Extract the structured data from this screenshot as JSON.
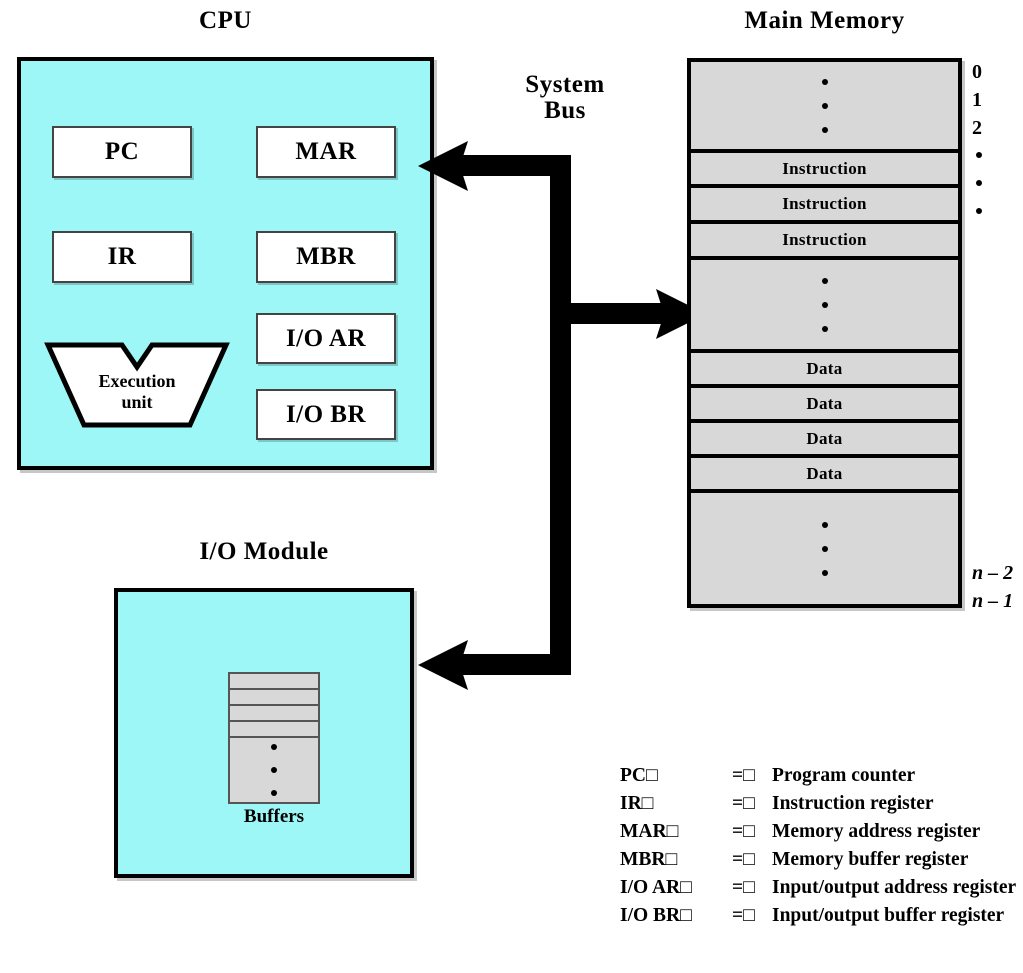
{
  "colors": {
    "component_fill": "#9ef7f7",
    "memory_fill": "#d8d8d8",
    "stroke": "#000000",
    "background": "#ffffff"
  },
  "cpu": {
    "title": "CPU",
    "registers": [
      {
        "label": "PC"
      },
      {
        "label": "MAR"
      },
      {
        "label": "IR"
      },
      {
        "label": "MBR"
      },
      {
        "label": "I/O AR"
      },
      {
        "label": "I/O BR"
      }
    ],
    "execution_unit": {
      "line1": "Execution",
      "line2": "unit"
    }
  },
  "bus": {
    "title_line1": "System",
    "title_line2": "Bus"
  },
  "memory": {
    "title": "Main Memory",
    "cells": [
      {
        "text": "",
        "type": "dots",
        "dots": 3
      },
      {
        "text": "Instruction",
        "type": "text"
      },
      {
        "text": "Instruction",
        "type": "text"
      },
      {
        "text": "Instruction",
        "type": "text"
      },
      {
        "text": "",
        "type": "dots",
        "dots": 3
      },
      {
        "text": "Data",
        "type": "text"
      },
      {
        "text": "Data",
        "type": "text"
      },
      {
        "text": "Data",
        "type": "text"
      },
      {
        "text": "Data",
        "type": "text"
      },
      {
        "text": "",
        "type": "dots",
        "dots": 3
      }
    ],
    "addresses_top": [
      "0",
      "1",
      "2"
    ],
    "addresses_bottom": [
      "n – 2",
      "n – 1"
    ]
  },
  "io_module": {
    "title": "I/O Module",
    "buffers_label": "Buffers",
    "buffer_rows": 4,
    "buffer_dots": 3
  },
  "legend": {
    "rows": [
      {
        "abbr": "PC□",
        "eq": "=□",
        "desc": "Program counter"
      },
      {
        "abbr": "IR□",
        "eq": "=□",
        "desc": "Instruction register"
      },
      {
        "abbr": "MAR□",
        "eq": "=□",
        "desc": "Memory address register"
      },
      {
        "abbr": "MBR□",
        "eq": "=□",
        "desc": "Memory buffer register"
      },
      {
        "abbr": "I/O AR□",
        "eq": "=□",
        "desc": "Input/output address register"
      },
      {
        "abbr": "I/O BR□",
        "eq": "=□",
        "desc": "Input/output buffer register"
      }
    ]
  }
}
